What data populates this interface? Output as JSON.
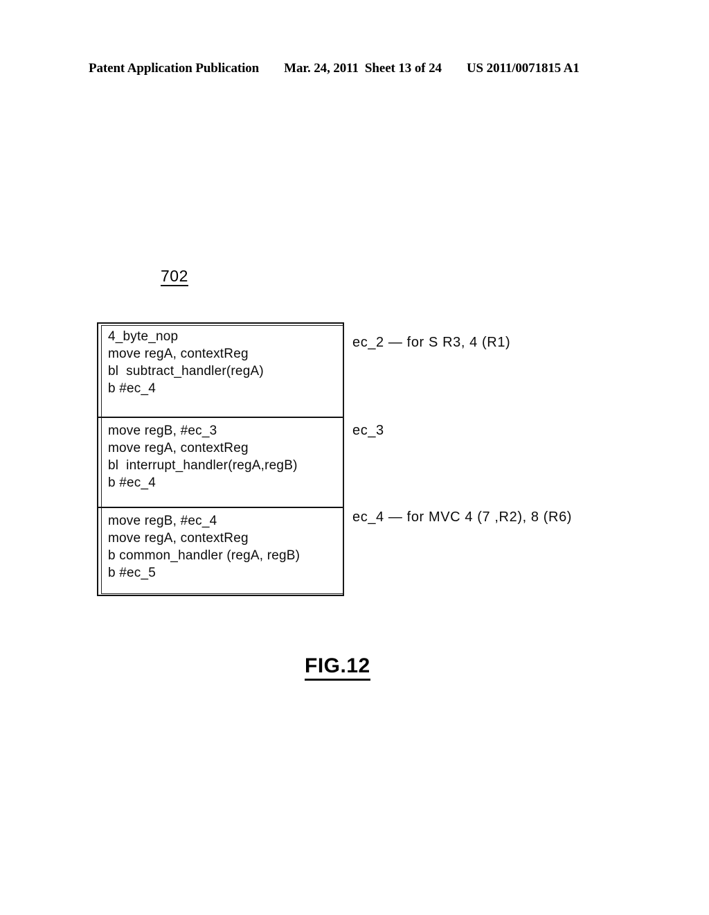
{
  "header": {
    "publication": "Patent Application Publication",
    "date": "Mar. 24, 2011",
    "sheet": "Sheet 13 of 24",
    "patent_number": "US 2011/0071815 A1"
  },
  "figure": {
    "reference_numeral": "702",
    "caption": "FIG.12",
    "blocks": [
      {
        "lines": [
          "4_byte_nop",
          "move regA, contextReg",
          "bl  subtract_handler(regA)",
          "b #ec_4"
        ],
        "annotation": "ec_2 — for S R3, 4 (R1)"
      },
      {
        "lines": [
          "move regB, #ec_3",
          "move regA, contextReg",
          "bl  interrupt_handler(regA,regB)",
          "b #ec_4"
        ],
        "annotation": "ec_3"
      },
      {
        "lines": [
          "move regB, #ec_4",
          "move regA, contextReg",
          "b common_handler (regA, regB)",
          "b #ec_5"
        ],
        "annotation": "ec_4 — for MVC 4 (7 ,R2), 8 (R6)"
      }
    ]
  },
  "colors": {
    "ink": "#111111",
    "page_background": "#ffffff"
  }
}
